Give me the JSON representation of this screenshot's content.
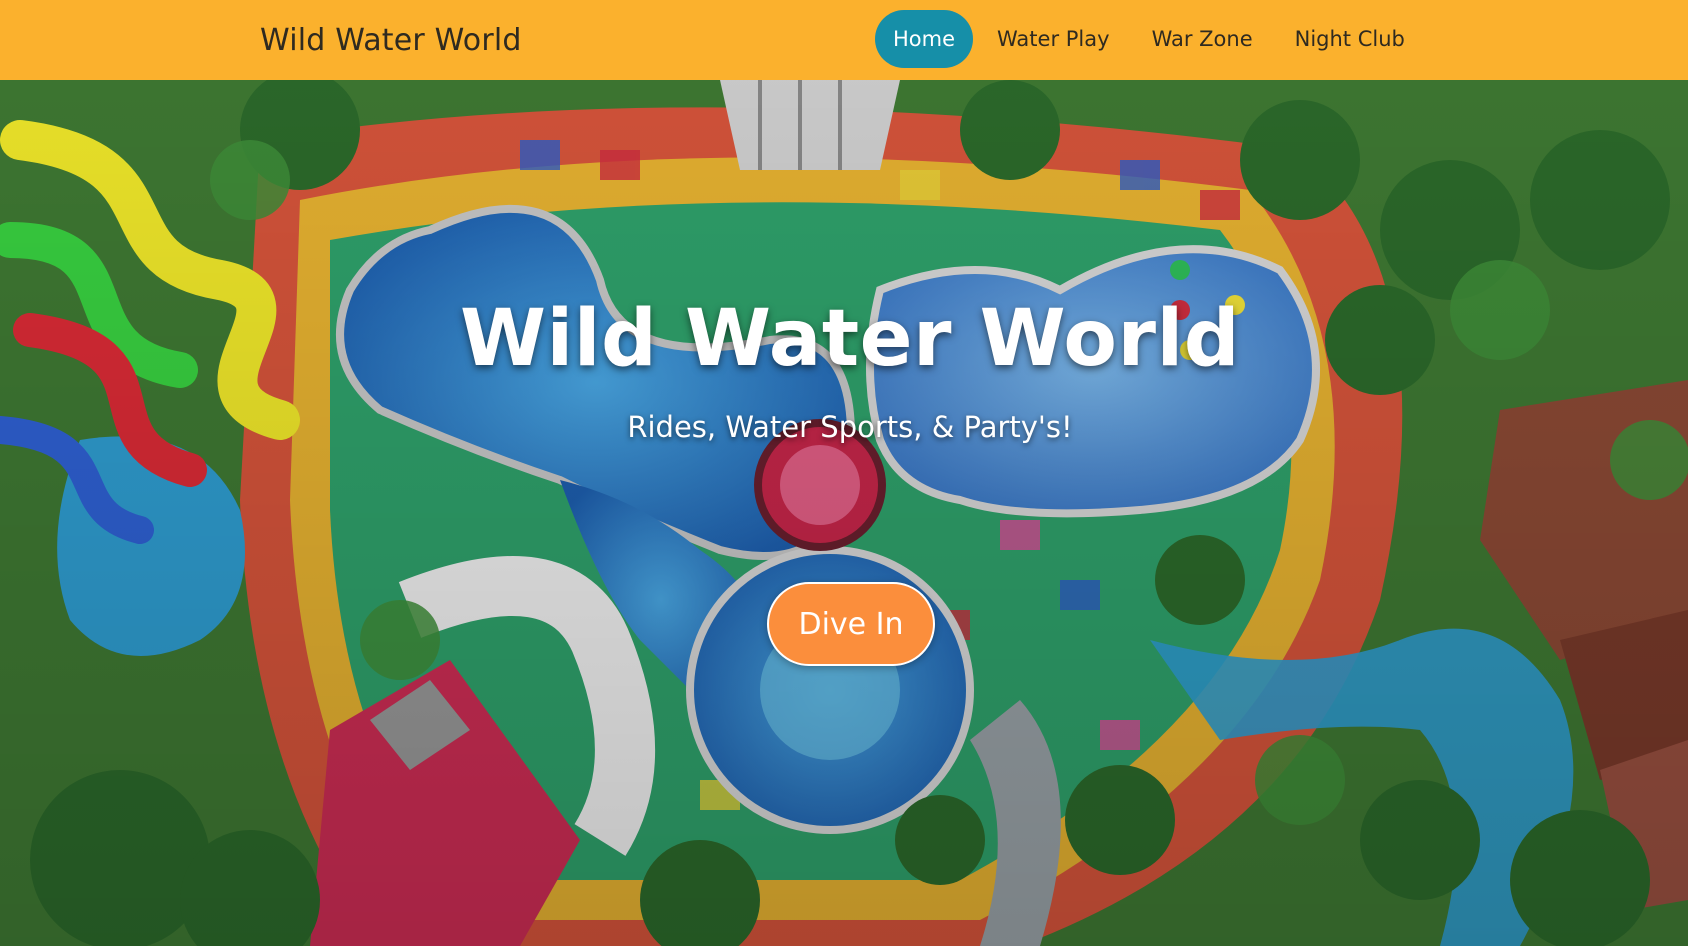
{
  "navbar": {
    "brand": "Wild Water World",
    "links": [
      {
        "label": "Home",
        "active": true
      },
      {
        "label": "Water Play",
        "active": false
      },
      {
        "label": "War Zone",
        "active": false
      },
      {
        "label": "Night Club",
        "active": false
      }
    ]
  },
  "hero": {
    "title": "Wild Water World",
    "subtitle": "Rides, Water Sports, & Party's!",
    "cta_label": "Dive In",
    "background_image": "aerial-waterpark-photo"
  },
  "colors": {
    "navbar_bg": "#fbb12d",
    "active_link_bg": "#168fa8",
    "cta_bg": "#fb8e3c",
    "text_dark": "#2f2a20",
    "text_light": "#ffffff"
  }
}
